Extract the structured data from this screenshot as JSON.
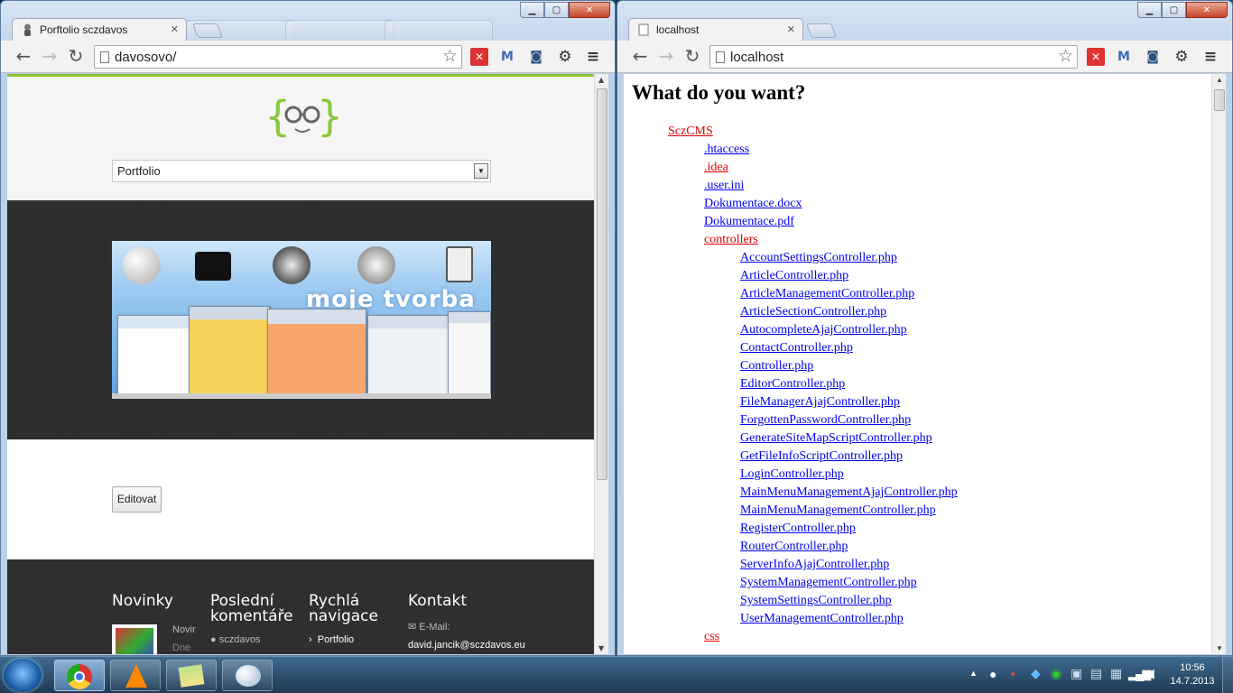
{
  "left_window": {
    "tab_title": "Porftolio sczdavos",
    "address": "davosovo/",
    "page": {
      "select_value": "Portfolio",
      "banner_title": "moje tvorba",
      "edit_button": "Editovat",
      "footer": {
        "col1": "Novinky",
        "col1_snippet_a": "Novir",
        "col1_snippet_b": "Dne",
        "col2": "Poslední komentáře",
        "col2_item": "sczdavos",
        "col3": "Rychlá navigace",
        "col3_item": "Portfolio",
        "col4": "Kontakt",
        "email_label": "E-Mail:",
        "email": "david.jancik@sczdavos.eu"
      }
    }
  },
  "right_window": {
    "tab_title": "localhost",
    "address": "localhost",
    "heading": "What do you want?",
    "tree": [
      {
        "label": "SczCMS",
        "type": "dir",
        "level": 0
      },
      {
        "label": ".htaccess",
        "type": "file",
        "level": 1
      },
      {
        "label": ".idea",
        "type": "dir",
        "level": 1
      },
      {
        "label": ".user.ini",
        "type": "file",
        "level": 1
      },
      {
        "label": "Dokumentace.docx",
        "type": "file",
        "level": 1
      },
      {
        "label": "Dokumentace.pdf",
        "type": "file",
        "level": 1
      },
      {
        "label": "controllers",
        "type": "dir",
        "level": 1
      },
      {
        "label": "AccountSettingsController.php",
        "type": "file",
        "level": 2
      },
      {
        "label": "ArticleController.php",
        "type": "file",
        "level": 2
      },
      {
        "label": "ArticleManagementController.php",
        "type": "file",
        "level": 2
      },
      {
        "label": "ArticleSectionController.php",
        "type": "file",
        "level": 2
      },
      {
        "label": "AutocompleteAjajController.php",
        "type": "file",
        "level": 2
      },
      {
        "label": "ContactController.php",
        "type": "file",
        "level": 2
      },
      {
        "label": "Controller.php",
        "type": "file",
        "level": 2
      },
      {
        "label": "EditorController.php",
        "type": "file",
        "level": 2
      },
      {
        "label": "FileManagerAjajController.php",
        "type": "file",
        "level": 2
      },
      {
        "label": "ForgottenPasswordController.php",
        "type": "file",
        "level": 2
      },
      {
        "label": "GenerateSiteMapScriptController.php",
        "type": "file",
        "level": 2
      },
      {
        "label": "GetFileInfoScriptController.php",
        "type": "file",
        "level": 2
      },
      {
        "label": "LoginController.php",
        "type": "file",
        "level": 2
      },
      {
        "label": "MainMenuManagementAjajController.php",
        "type": "file",
        "level": 2
      },
      {
        "label": "MainMenuManagementController.php",
        "type": "file",
        "level": 2
      },
      {
        "label": "RegisterController.php",
        "type": "file",
        "level": 2
      },
      {
        "label": "RouterController.php",
        "type": "file",
        "level": 2
      },
      {
        "label": "ServerInfoAjajController.php",
        "type": "file",
        "level": 2
      },
      {
        "label": "SystemManagementController.php",
        "type": "file",
        "level": 2
      },
      {
        "label": "SystemSettingsController.php",
        "type": "file",
        "level": 2
      },
      {
        "label": "UserManagementController.php",
        "type": "file",
        "level": 2
      },
      {
        "label": "css",
        "type": "dir",
        "level": 1
      }
    ]
  },
  "taskbar": {
    "time": "10:56",
    "date": "14.7.2013"
  },
  "colors": {
    "accent_green": "#8dc63f",
    "dir_link": "#e00000",
    "file_link": "#0000ee",
    "footer_dark": "#2f2f2f"
  }
}
